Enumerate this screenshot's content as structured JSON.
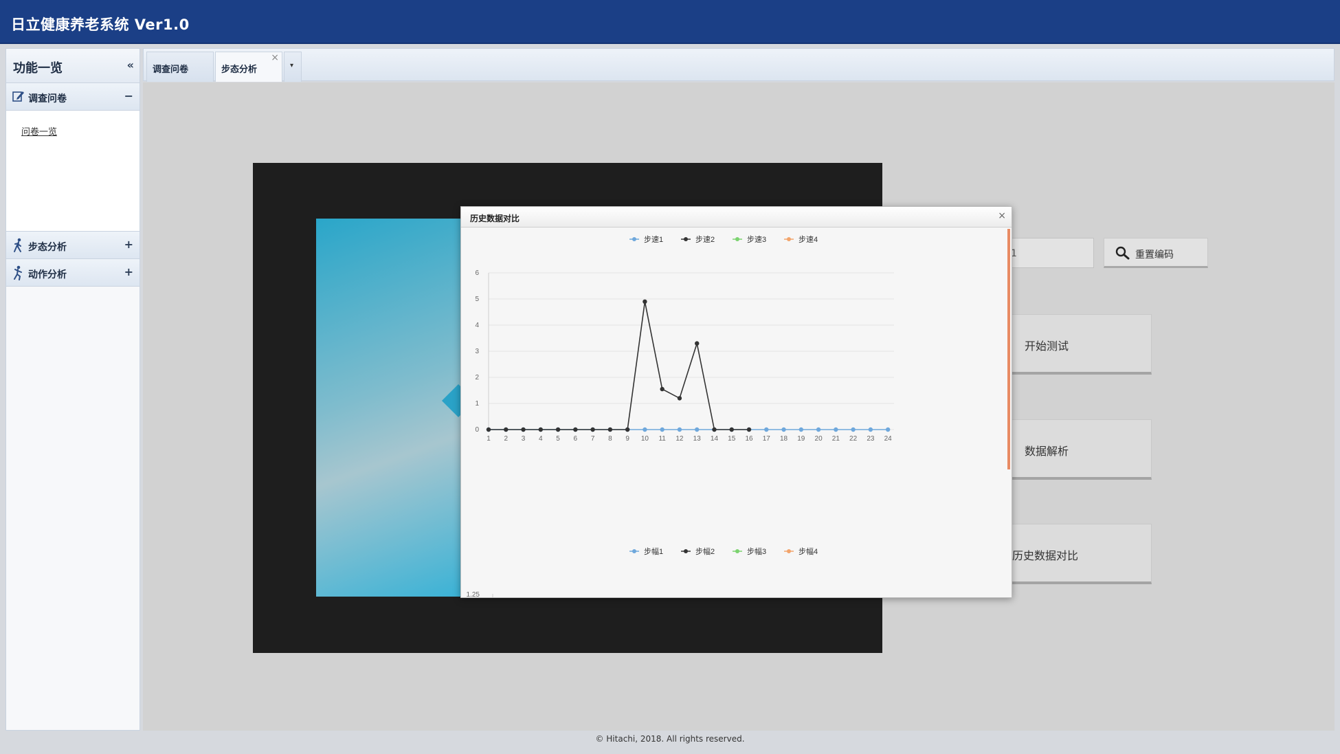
{
  "app": {
    "title": "日立健康养老系统 Ver1.0"
  },
  "sidebar": {
    "title": "功能一览",
    "collapse_glyph": "«",
    "sections": [
      {
        "label": "调查问卷",
        "toggle": "−",
        "icon": "edit-icon",
        "items": [
          {
            "label": "问卷一览"
          }
        ]
      },
      {
        "label": "步态分析",
        "toggle": "+",
        "icon": "walking-icon"
      },
      {
        "label": "动作分析",
        "toggle": "+",
        "icon": "running-icon"
      }
    ]
  },
  "tabs": [
    {
      "label": "调查问卷",
      "active": false
    },
    {
      "label": "步态分析",
      "active": true,
      "close_glyph": "×"
    }
  ],
  "tab_dropdown_glyph": "▾",
  "main": {
    "code_input": {
      "value": "1"
    },
    "reset_code_button": "重置编码",
    "buttons": {
      "start_test": "开始测试",
      "data_analysis": "数据解析",
      "history_compare": "历史数据对比"
    }
  },
  "dialog": {
    "title": "历史数据对比",
    "close_glyph": "×"
  },
  "chart_data": [
    {
      "type": "line",
      "x": [
        1,
        2,
        3,
        4,
        5,
        6,
        7,
        8,
        9,
        10,
        11,
        12,
        13,
        14,
        15,
        16,
        17,
        18,
        19,
        20,
        21,
        22,
        23,
        24
      ],
      "ylim": [
        0,
        6
      ],
      "yticks": [
        "0",
        "1",
        "2",
        "3",
        "4",
        "5",
        "6"
      ],
      "legend_position": "top",
      "grid": true,
      "series": [
        {
          "name": "步速1",
          "color": "#6fa8dc",
          "values": [
            0,
            0,
            0,
            0,
            0,
            0,
            0,
            0,
            0,
            0,
            0,
            0,
            0,
            0,
            0,
            0,
            0,
            0,
            0,
            0,
            0,
            0,
            0,
            0
          ]
        },
        {
          "name": "步速2",
          "color": "#333333",
          "values": [
            0,
            0,
            0,
            0,
            0,
            0,
            0,
            0,
            0,
            4.9,
            1.55,
            1.2,
            3.3,
            0,
            0,
            0,
            null,
            null,
            null,
            null,
            null,
            null,
            null,
            null
          ]
        },
        {
          "name": "步速3",
          "color": "#7bd36f",
          "values": []
        },
        {
          "name": "步速4",
          "color": "#f2a46b",
          "values": []
        }
      ]
    },
    {
      "type": "line",
      "legend_position": "top",
      "yticks": [
        "1.25"
      ],
      "series": [
        {
          "name": "步幅1",
          "color": "#6fa8dc"
        },
        {
          "name": "步幅2",
          "color": "#333333"
        },
        {
          "name": "步幅3",
          "color": "#7bd36f"
        },
        {
          "name": "步幅4",
          "color": "#f2a46b"
        }
      ]
    }
  ],
  "footer": {
    "text": "© Hitachi, 2018. All rights reserved."
  }
}
